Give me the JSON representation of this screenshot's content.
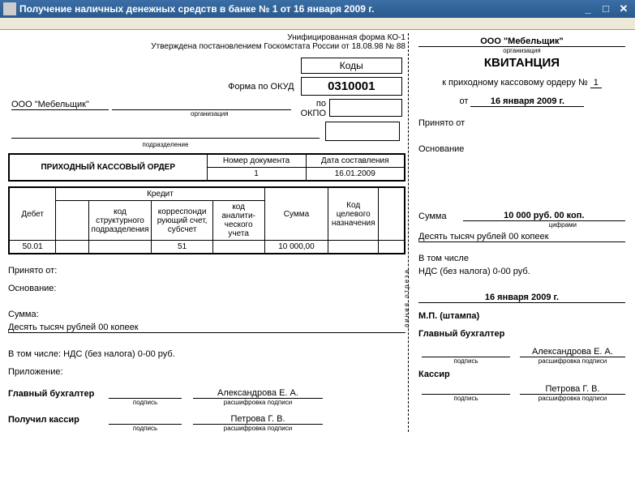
{
  "window": {
    "title": "Получение наличных денежных средств в банке № 1 от 16 января 2009 г."
  },
  "form_header": {
    "unified": "Унифицированная форма КО-1",
    "approved": "Утверждена постановлением Госкомстата России от 18.08.98 № 88"
  },
  "codes": {
    "header": "Коды",
    "okud_label": "Форма по ОКУД",
    "okud_value": "0310001",
    "okpo_label": "по ОКПО",
    "okpo_value": ""
  },
  "org": {
    "name": "ООО \"Мебельщик\"",
    "org_label": "организация",
    "dept_label": "подразделение",
    "dept_value": ""
  },
  "order": {
    "title": "ПРИХОДНЫЙ КАССОВЫЙ ОРДЕР",
    "doc_num_label": "Номер документа",
    "doc_num": "1",
    "date_label": "Дата составления",
    "date": "16.01.2009"
  },
  "table": {
    "debit": "Дебет",
    "credit": "Кредит",
    "code_struct": "код структурного подразделения",
    "corr_acc": "корреспонди рующий счет, субсчет",
    "anal_code": "код аналити- ческого учета",
    "sum": "Сумма",
    "purpose": "Код целевого назначения",
    "blank": "",
    "row": {
      "debit": "50.01",
      "code_struct": "",
      "corr_acc": "51",
      "anal_code": "",
      "sum": "10 000,00",
      "purpose": "",
      "blank": ""
    }
  },
  "body": {
    "received_from_label": "Принято от:",
    "received_from": "",
    "basis_label": "Основание:",
    "basis": "",
    "sum_label": "Сумма:",
    "sum_words": "Десять тысяч рублей 00 копеек",
    "incl_label": "В том числе: НДС (без налога) 0-00 руб.",
    "attach_label": "Приложение:",
    "chief_acc": "Главный бухгалтер",
    "chief_acc_name": "Александрова Е. А.",
    "cashier_label": "Получил кассир",
    "cashier_name": "Петрова Г. В.",
    "sign_label": "подпись",
    "decipher_label": "расшифровка подписи"
  },
  "receipt": {
    "org": "ООО \"Мебельщик\"",
    "org_label": "организация",
    "title": "КВИТАНЦИЯ",
    "to_order": "к приходному кассовому ордеру №",
    "order_num": "1",
    "date_label": "от",
    "date": "16 января 2009 г.",
    "received_from_label": "Принято от",
    "basis_label": "Основание",
    "sum_label": "Сумма",
    "sum_value": "10 000 руб. 00 коп.",
    "sum_digits_label": "цифрами",
    "sum_words": "Десять тысяч рублей 00 копеек",
    "incl_label": "В том числе",
    "incl_value": "НДС (без налога) 0-00 руб.",
    "date2": "16 января 2009 г.",
    "stamp": "М.П. (штампа)",
    "chief_acc": "Главный бухгалтер",
    "chief_acc_name": "Александрова Е. А.",
    "cashier": "Кассир",
    "cashier_name": "Петрова Г. В.",
    "sign_label": "подпись",
    "decipher_label": "расшифровка подписи",
    "cutline": "линия отреза"
  }
}
